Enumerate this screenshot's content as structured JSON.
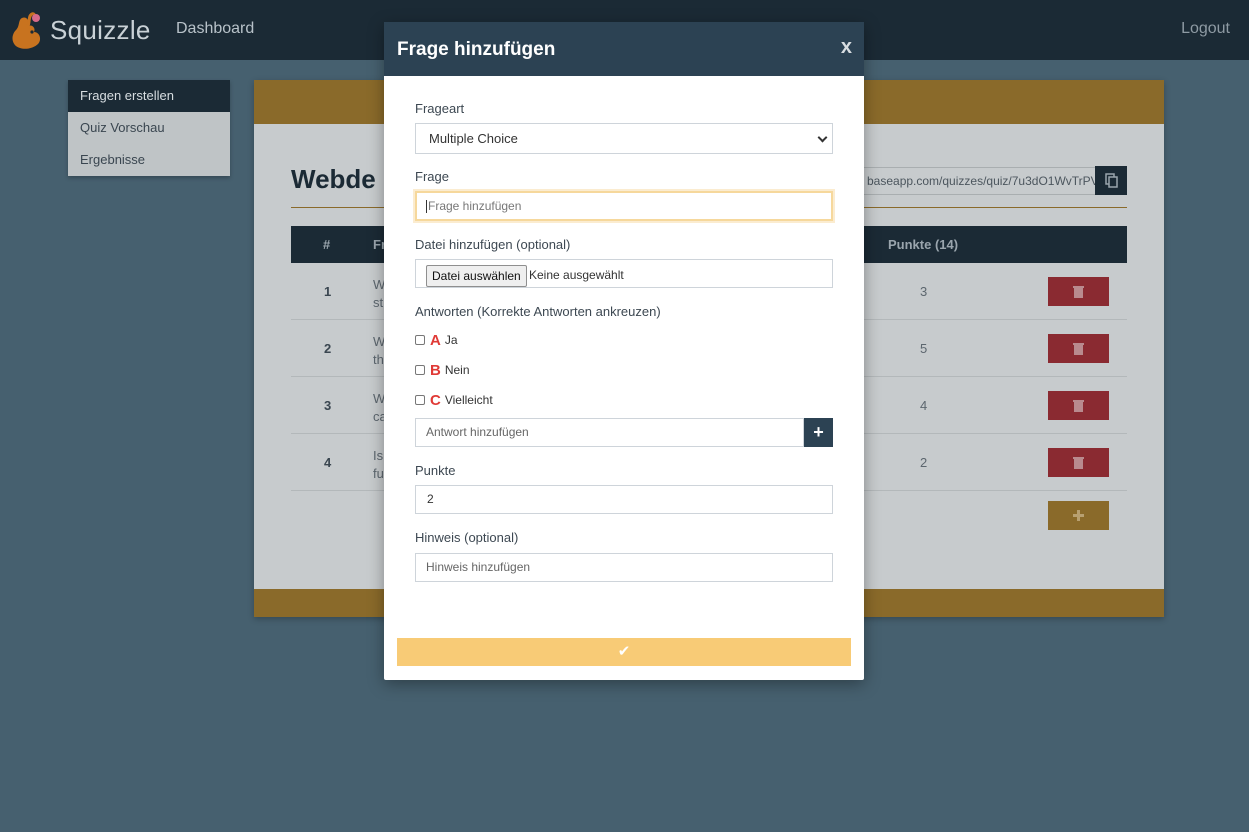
{
  "navbar": {
    "brand": "Squizzle",
    "logo_icon": "squirrel-logo",
    "dashboard": "Dashboard",
    "logout": "Logout"
  },
  "sidebar": {
    "items": [
      {
        "label": "Fragen erstellen",
        "active": true
      },
      {
        "label": "Quiz Vorschau",
        "active": false
      },
      {
        "label": "Ergebnisse",
        "active": false
      }
    ]
  },
  "quiz": {
    "title": "Webde",
    "url": "baseapp.com/quizzes/quiz/7u3dO1WvTrPV",
    "table": {
      "headers": {
        "num": "#",
        "question": "Fr",
        "points": "Punkte (14)"
      },
      "rows": [
        {
          "num": "1",
          "q": "W st",
          "points": "3"
        },
        {
          "num": "2",
          "q": "W th",
          "points": "5"
        },
        {
          "num": "3",
          "q": "W ca",
          "points": "4"
        },
        {
          "num": "4",
          "q": "Is fu",
          "points": "2"
        }
      ]
    }
  },
  "modal": {
    "title": "Frage hinzufügen",
    "close": "x",
    "frageart_label": "Frageart",
    "frageart_value": "Multiple Choice",
    "frage_label": "Frage",
    "frage_placeholder": "Frage hinzufügen",
    "datei_label": "Datei hinzufügen (optional)",
    "datei_button": "Datei auswählen",
    "datei_none": "Keine ausgewählt",
    "antworten_label": "Antworten (Korrekte Antworten ankreuzen)",
    "answers": [
      {
        "letter": "A",
        "text": "Ja",
        "checked": false
      },
      {
        "letter": "B",
        "text": "Nein",
        "checked": false
      },
      {
        "letter": "C",
        "text": "Vielleicht",
        "checked": false
      }
    ],
    "answer_placeholder": "Antwort hinzufügen",
    "add_answer": "+",
    "punkte_label": "Punkte",
    "punkte_value": "2",
    "hinweis_label": "Hinweis (optional)",
    "hinweis_placeholder": "Hinweis hinzufügen",
    "submit": "✔"
  },
  "colors": {
    "navbar": "#1b2a35",
    "modal_header": "#2c4253",
    "accent": "#f8cb76",
    "danger": "#dc3545",
    "letter": "#e03a36"
  }
}
